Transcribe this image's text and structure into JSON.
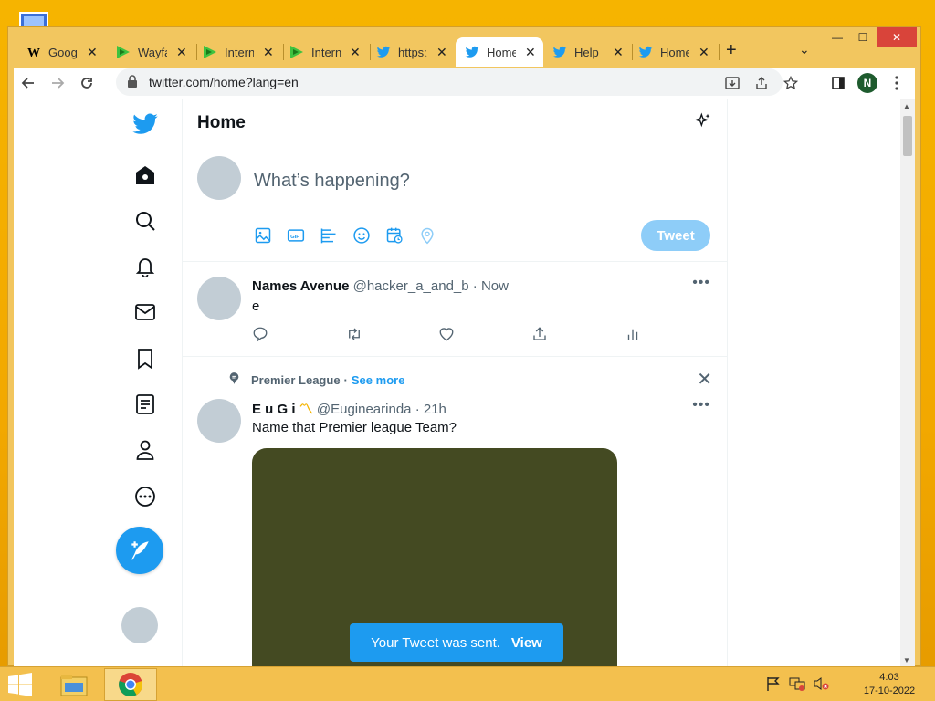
{
  "tabs": [
    {
      "title": "Google",
      "favicon": "wikipedia-icon"
    },
    {
      "title": "Wayfair",
      "favicon": "green-arrow-icon"
    },
    {
      "title": "Internet",
      "favicon": "green-arrow-icon"
    },
    {
      "title": "Internet",
      "favicon": "green-arrow-icon"
    },
    {
      "title": "https://",
      "favicon": "twitter-bird-icon"
    },
    {
      "title": "Home",
      "favicon": "twitter-bird-icon",
      "active": true
    },
    {
      "title": "Help",
      "favicon": "twitter-bird-icon"
    },
    {
      "title": "Home",
      "favicon": "twitter-bird-icon"
    }
  ],
  "address_bar": {
    "url": "twitter.com/home?lang=en"
  },
  "profile": {
    "initial": "N"
  },
  "timeline": {
    "title": "Home",
    "composer_placeholder": "What’s happening?",
    "tweet_button": "Tweet"
  },
  "tweets": [
    {
      "name": "Names Avenue",
      "handle": "@hacker_a_and_b",
      "time": "· Now",
      "text": "e"
    },
    {
      "context_label": "Premier League",
      "context_sep": "·",
      "context_link": "See more",
      "name": "E u G i",
      "handle": "@Euginearinda",
      "time": "· 21h",
      "text": "Name that Premier league Team?"
    }
  ],
  "toast": {
    "message": "Your Tweet was sent.",
    "action": "View"
  },
  "taskbar": {
    "time": "4:03",
    "date": "17-10-2022"
  },
  "colors": {
    "accent": "#1d9bf0",
    "tweet_disabled": "#8ecdf8",
    "media_bg": "#444a22",
    "desktop": "#f6b400"
  }
}
